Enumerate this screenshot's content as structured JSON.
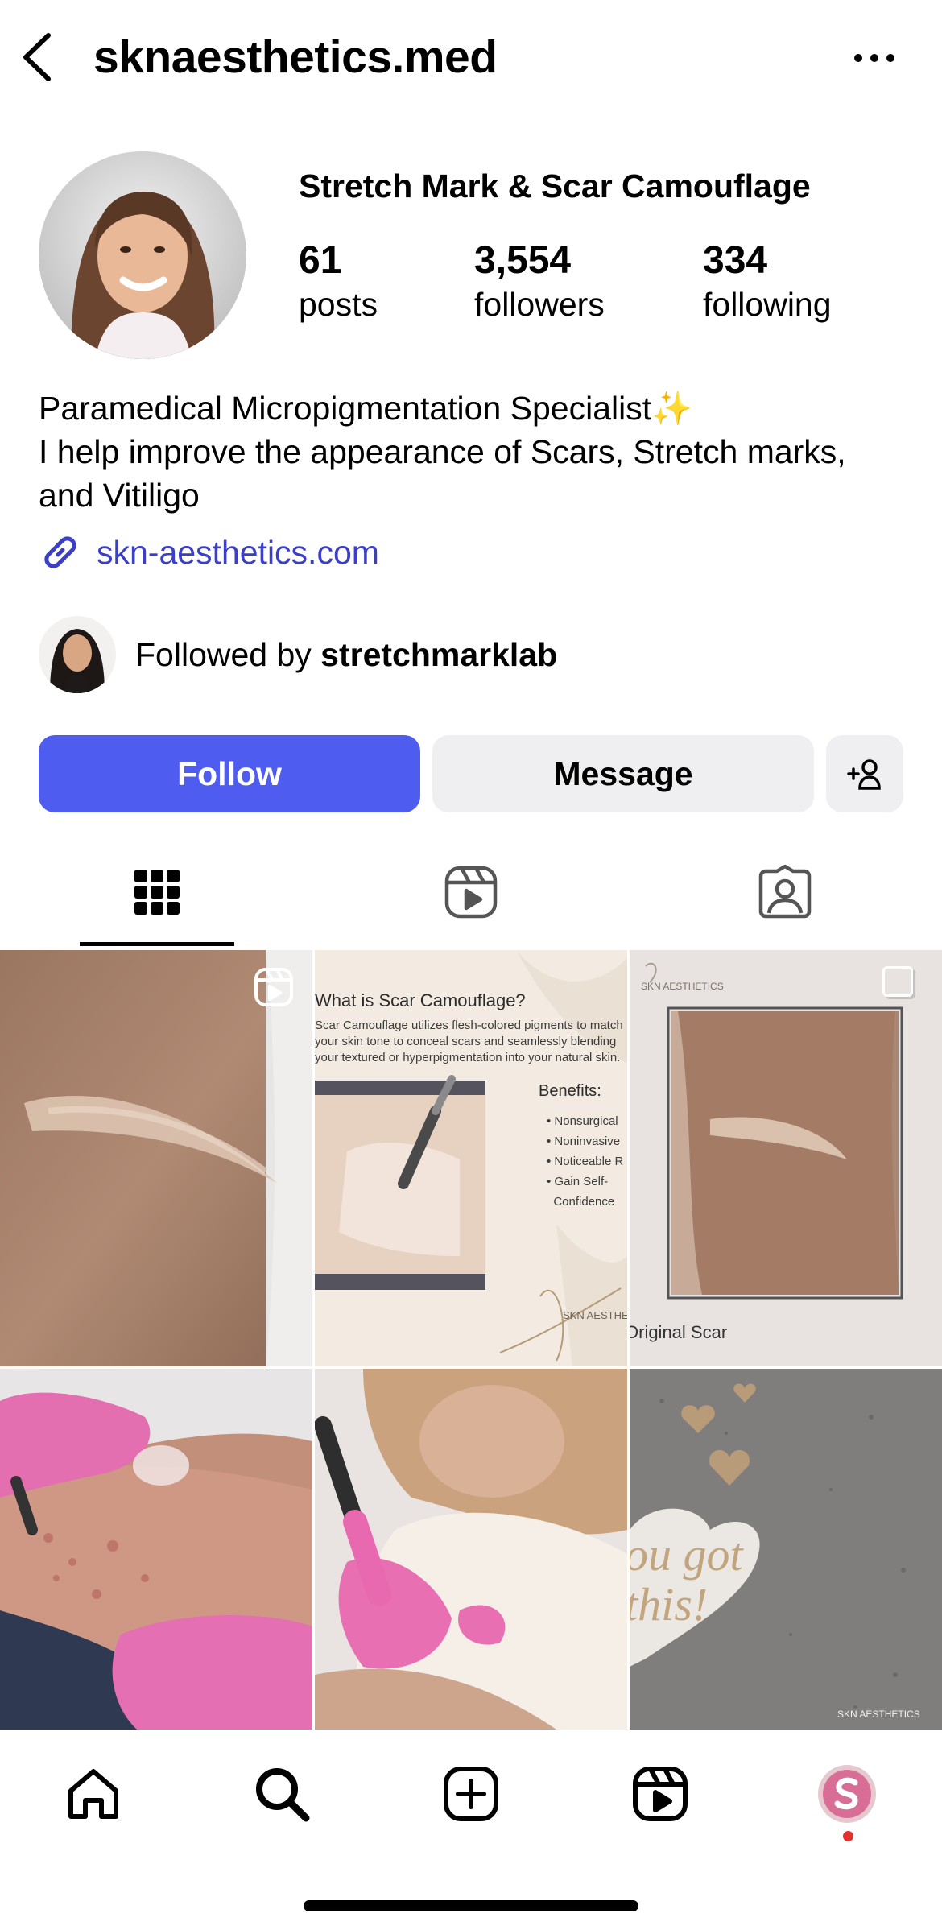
{
  "header": {
    "username": "sknaesthetics.med"
  },
  "profile": {
    "display_name": "Stretch Mark & Scar Camouflage",
    "stats": [
      {
        "value": "61",
        "label": "posts"
      },
      {
        "value": "3,554",
        "label": "followers"
      },
      {
        "value": "334",
        "label": "following"
      }
    ],
    "bio_lines": [
      "Paramedical Micropigmentation Specialist✨",
      "I help improve the appearance of Scars, Stretch marks,",
      "and Vitiligo"
    ],
    "link": "skn-aesthetics.com",
    "followed_by_prefix": "Followed by ",
    "followed_by_user": "stretchmarklab"
  },
  "actions": {
    "follow": "Follow",
    "message": "Message"
  },
  "tabs": [
    "grid-icon",
    "reels-icon",
    "tagged-icon"
  ],
  "posts": {
    "post2": {
      "title": "What is Scar Camouflage?",
      "body_lines": [
        "Scar Camouflage utilizes flesh-colored pigments to match",
        "your skin tone to conceal scars and seamlessly blending",
        "your textured or hyperpigmentation into your natural skin."
      ],
      "benefits_title": "Benefits:",
      "benefits": [
        "Nonsurgical",
        "Noninvasive",
        "Noticeable R",
        "Gain Self-",
        "Confidence"
      ],
      "brand": "SKN AESTHETICS"
    },
    "post3": {
      "brand": "SKN AESTHETICS",
      "caption": "Original Scar"
    },
    "post6": {
      "text_lines": [
        "ou got",
        "this!"
      ],
      "brand": "SKN AESTHETICS"
    }
  },
  "colors": {
    "follow_button": "#4f5cf0",
    "link": "#3b3fc8",
    "secondary_button": "#efeff2",
    "notification_dot": "#e0312e"
  },
  "bottom_nav": [
    "home-icon",
    "search-icon",
    "create-icon",
    "reels-icon",
    "profile-avatar"
  ]
}
